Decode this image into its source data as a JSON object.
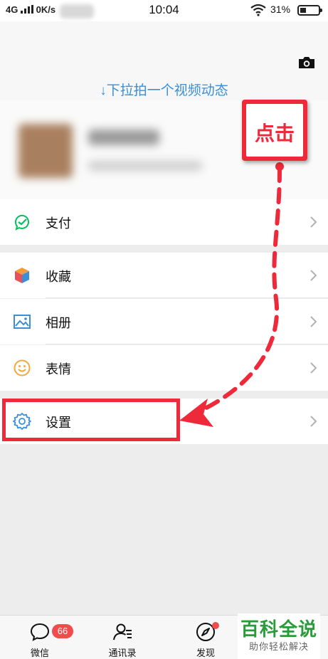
{
  "status_bar": {
    "network": "4G",
    "speed": "0K/s",
    "time": "10:04",
    "battery_percent": "31%"
  },
  "header": {
    "pull_hint": "↓下拉拍一个视频动态"
  },
  "menu": {
    "pay": "支付",
    "favorites": "收藏",
    "album": "相册",
    "stickers": "表情",
    "settings": "设置"
  },
  "annotation": {
    "callout_text": "点击",
    "color": "#ee2a3a"
  },
  "tabbar": {
    "chats": "微信",
    "chats_badge": "66",
    "contacts": "通讯录",
    "discover": "发现"
  },
  "watermark": {
    "name": "百科全说",
    "tagline": "助你轻松解决"
  },
  "colors": {
    "accent_blue": "#3a8fd8",
    "wechat_green": "#07c160",
    "badge_red": "#f24b4b"
  }
}
